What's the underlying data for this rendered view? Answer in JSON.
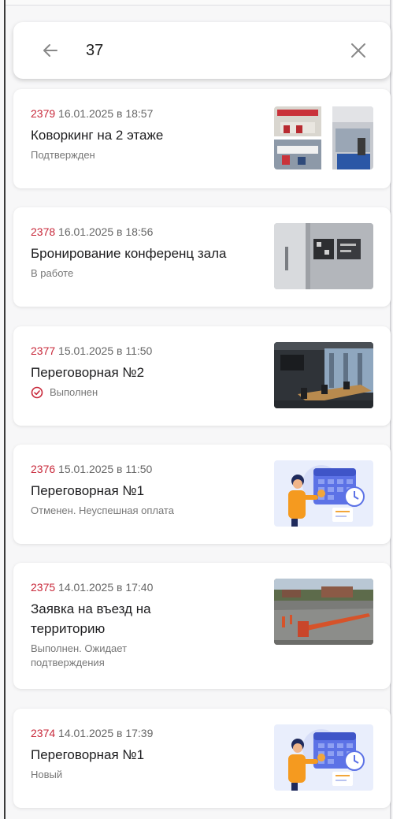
{
  "search": {
    "query": "37"
  },
  "orders": [
    {
      "number": "2379",
      "datetime": "16.01.2025 в 18:57",
      "title": "Коворкинг на 2 этаже",
      "status": "Подтвержден",
      "image": "coworking-photos"
    },
    {
      "number": "2378",
      "datetime": "16.01.2025 в 18:56",
      "title": "Бронирование конференц зала",
      "status": "В работе",
      "image": "glass-door-photo"
    },
    {
      "number": "2377",
      "datetime": "15.01.2025 в 11:50",
      "title": "Переговорная №2",
      "status": "Выполнен",
      "image": "meeting-room-photo"
    },
    {
      "number": "2376",
      "datetime": "15.01.2025 в 11:50",
      "title": "Переговорная №1",
      "status": "Отменен. Неуспешная оплата",
      "image": "calendar-illustration"
    },
    {
      "number": "2375",
      "datetime": "14.01.2025 в 17:40",
      "title": "Заявка на въезд на территорию",
      "status": "Выполнен. Ожидает подтверждения",
      "image": "barrier-gate-photo"
    },
    {
      "number": "2374",
      "datetime": "14.01.2025 в 17:39",
      "title": "Переговорная №1",
      "status": "Новый",
      "image": "calendar-illustration"
    }
  ],
  "colors": {
    "accent": "#c8283a",
    "background": "#f7f7f8",
    "card": "#ffffff"
  }
}
